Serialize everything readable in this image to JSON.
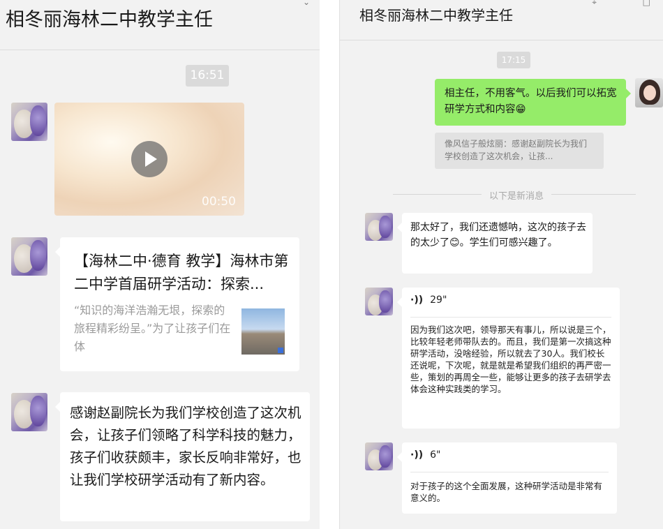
{
  "left": {
    "title": "相冬丽海林二中教学主任",
    "timestamp": "16:51",
    "video_duration": "00:50",
    "link": {
      "title": "【海林二中·德育 教学】海林市第二中学首届研学活动：探索...",
      "description": "“知识的海洋浩瀚无垠，探索的旅程精彩纷呈。”为了让孩子们在体"
    },
    "message": "感谢赵副院长为我们学校创造了这次机会，让孩子们领略了科学科技的魅力，孩子们收获颇丰，家长反响非常好，也让我们学校研学活动有了新内容。"
  },
  "right": {
    "title": "相冬丽海林二中教学主任",
    "timestamp": "17:15",
    "my_message": "相主任，不用客气。以后我们可以拓宽研学方式和内容",
    "quote": "像风信子般炫丽：感谢赵副院长为我们学校创造了这次机会，让孩...",
    "new_divider": "以下是新消息",
    "message1": "那太好了，我们还遗憾呐，这次的孩子去的太少了",
    "message1_tail": "。学生们可感兴趣了。",
    "voice1": {
      "icon": "·))",
      "duration": "29\"",
      "transcript": "因为我们这次吧，领导那天有事儿，所以说是三个，比较年轻老师带队去的。而且，我们是第一次搞这种研学活动，没啥经验，所以就去了30人。我们校长还说呢，下次呢，就是就是希望我们组织的再严密一些，策划的再周全一些，能够让更多的孩子去研学去体会这种实践类的学习。"
    },
    "voice2": {
      "icon": "·))",
      "duration": "6\"",
      "transcript": "对于孩子的这个全面发展，这种研学活动是非常有意义的。"
    }
  },
  "icons": {
    "grin": "😁",
    "smile": "😊"
  }
}
